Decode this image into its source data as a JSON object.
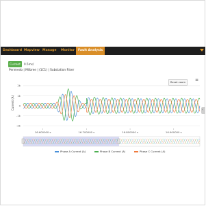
{
  "nav": {
    "items": [
      "Dashboard",
      "Mapview",
      "Manage",
      "Monitor",
      "Fault Analysis"
    ],
    "active": "Fault Analysis"
  },
  "toolbar": {
    "current_label": "Current",
    "freq_label": "0.5ms/"
  },
  "breadcrumb": "Penmedo | Milbree | (1C1) | Substation Riser",
  "reset_zoom_label": "Reset zoom",
  "menu_icon": "hamburger-menu-icon",
  "colors": {
    "nav_bg": "#1e1e1e",
    "nav_text": "#e09a2d",
    "nav_active": "#d98e28",
    "current_button": "#5aae4b",
    "phase_a": "#4a90d9",
    "phase_b": "#4caf50",
    "phase_c": "#f07b3f"
  },
  "chart_data": {
    "type": "line",
    "ylabel": "Current (A)",
    "yticks": [
      "2k",
      "1k",
      "0",
      "-1k",
      "-2k"
    ],
    "ylim": [
      -2200,
      2200
    ],
    "xticks": [
      "16.600000 s",
      "16.700000 s",
      "16.800000 s",
      "16.900000 s"
    ],
    "xlim": [
      16.555,
      16.96
    ],
    "series": [
      {
        "name": "Phase A Current (A)",
        "color": "#4a90d9",
        "phase": 0,
        "pre_amp": 250,
        "fault_amp": 1500,
        "post_amp": 700
      },
      {
        "name": "Phase B Current (A)",
        "color": "#4caf50",
        "phase": 2.094,
        "pre_amp": 250,
        "fault_amp": 1700,
        "post_amp": 750
      },
      {
        "name": "Phase C Current (A)",
        "color": "#f07b3f",
        "phase": 4.189,
        "pre_amp": 250,
        "fault_amp": 1200,
        "post_amp": 650
      }
    ],
    "frequency_hz": 50,
    "fault_start": 16.63,
    "fault_peak_end": 16.7
  }
}
